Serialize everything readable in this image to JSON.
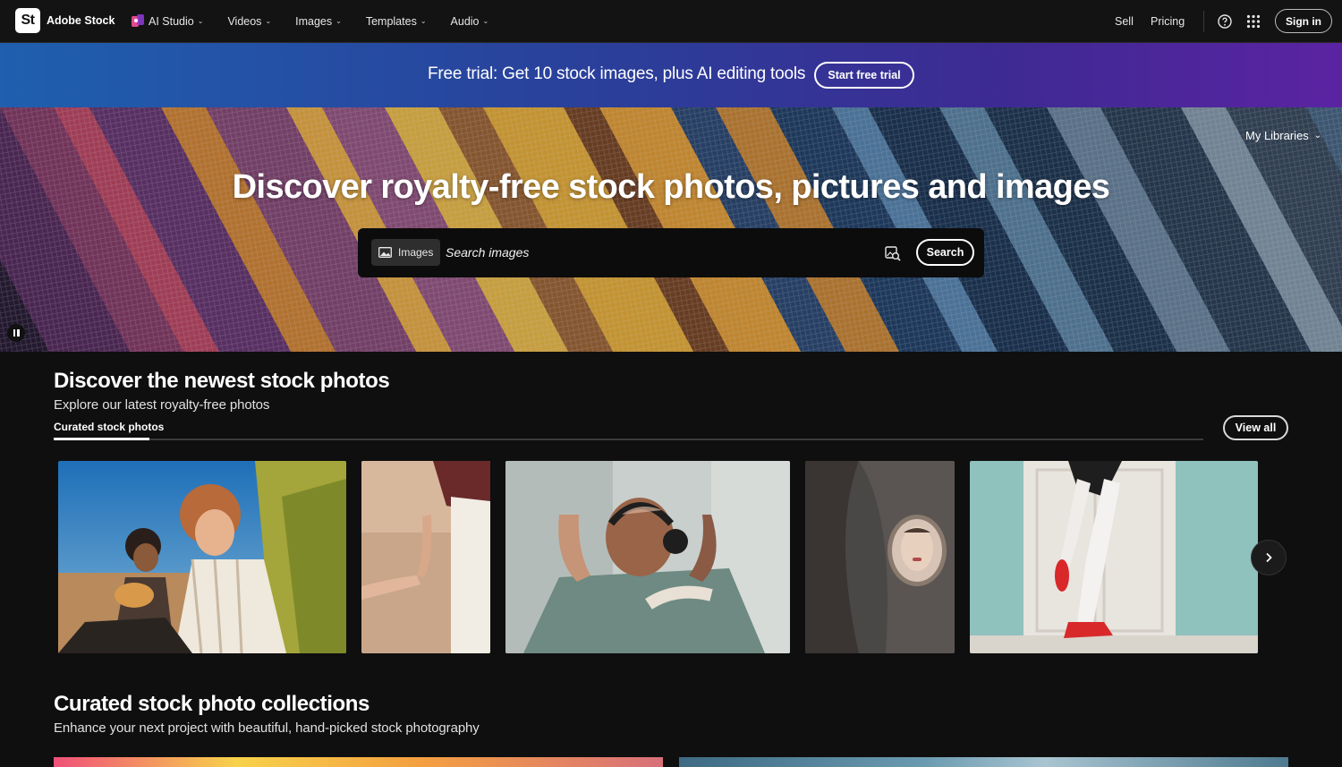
{
  "brand": {
    "logo": "St",
    "name": "Adobe Stock"
  },
  "nav": {
    "links": [
      {
        "label": "AI Studio",
        "icon": "ai-studio-icon"
      },
      {
        "label": "Videos"
      },
      {
        "label": "Images"
      },
      {
        "label": "Templates"
      },
      {
        "label": "Audio"
      }
    ],
    "sell": "Sell",
    "pricing": "Pricing",
    "signin": "Sign in"
  },
  "promo": {
    "text": "Free trial: Get 10 stock images, plus AI editing tools",
    "button": "Start free trial"
  },
  "hero": {
    "my_libraries": "My Libraries",
    "title": "Discover royalty-free stock photos, pictures and images",
    "search_type": "Images",
    "search_placeholder": "Search images",
    "search_button": "Search"
  },
  "newest": {
    "title": "Discover the newest stock photos",
    "subtitle": "Explore our latest royalty-free photos",
    "tab": "Curated stock photos",
    "view_all": "View all"
  },
  "collections": {
    "title": "Curated stock photo collections",
    "subtitle": "Enhance your next project with beautiful, hand-picked stock photography"
  },
  "colors": {
    "page_bg": "#0f0f0f",
    "nav_bg": "#131313",
    "promo_gradient_start": "#1f5fae",
    "promo_gradient_end": "#5b23a2"
  }
}
